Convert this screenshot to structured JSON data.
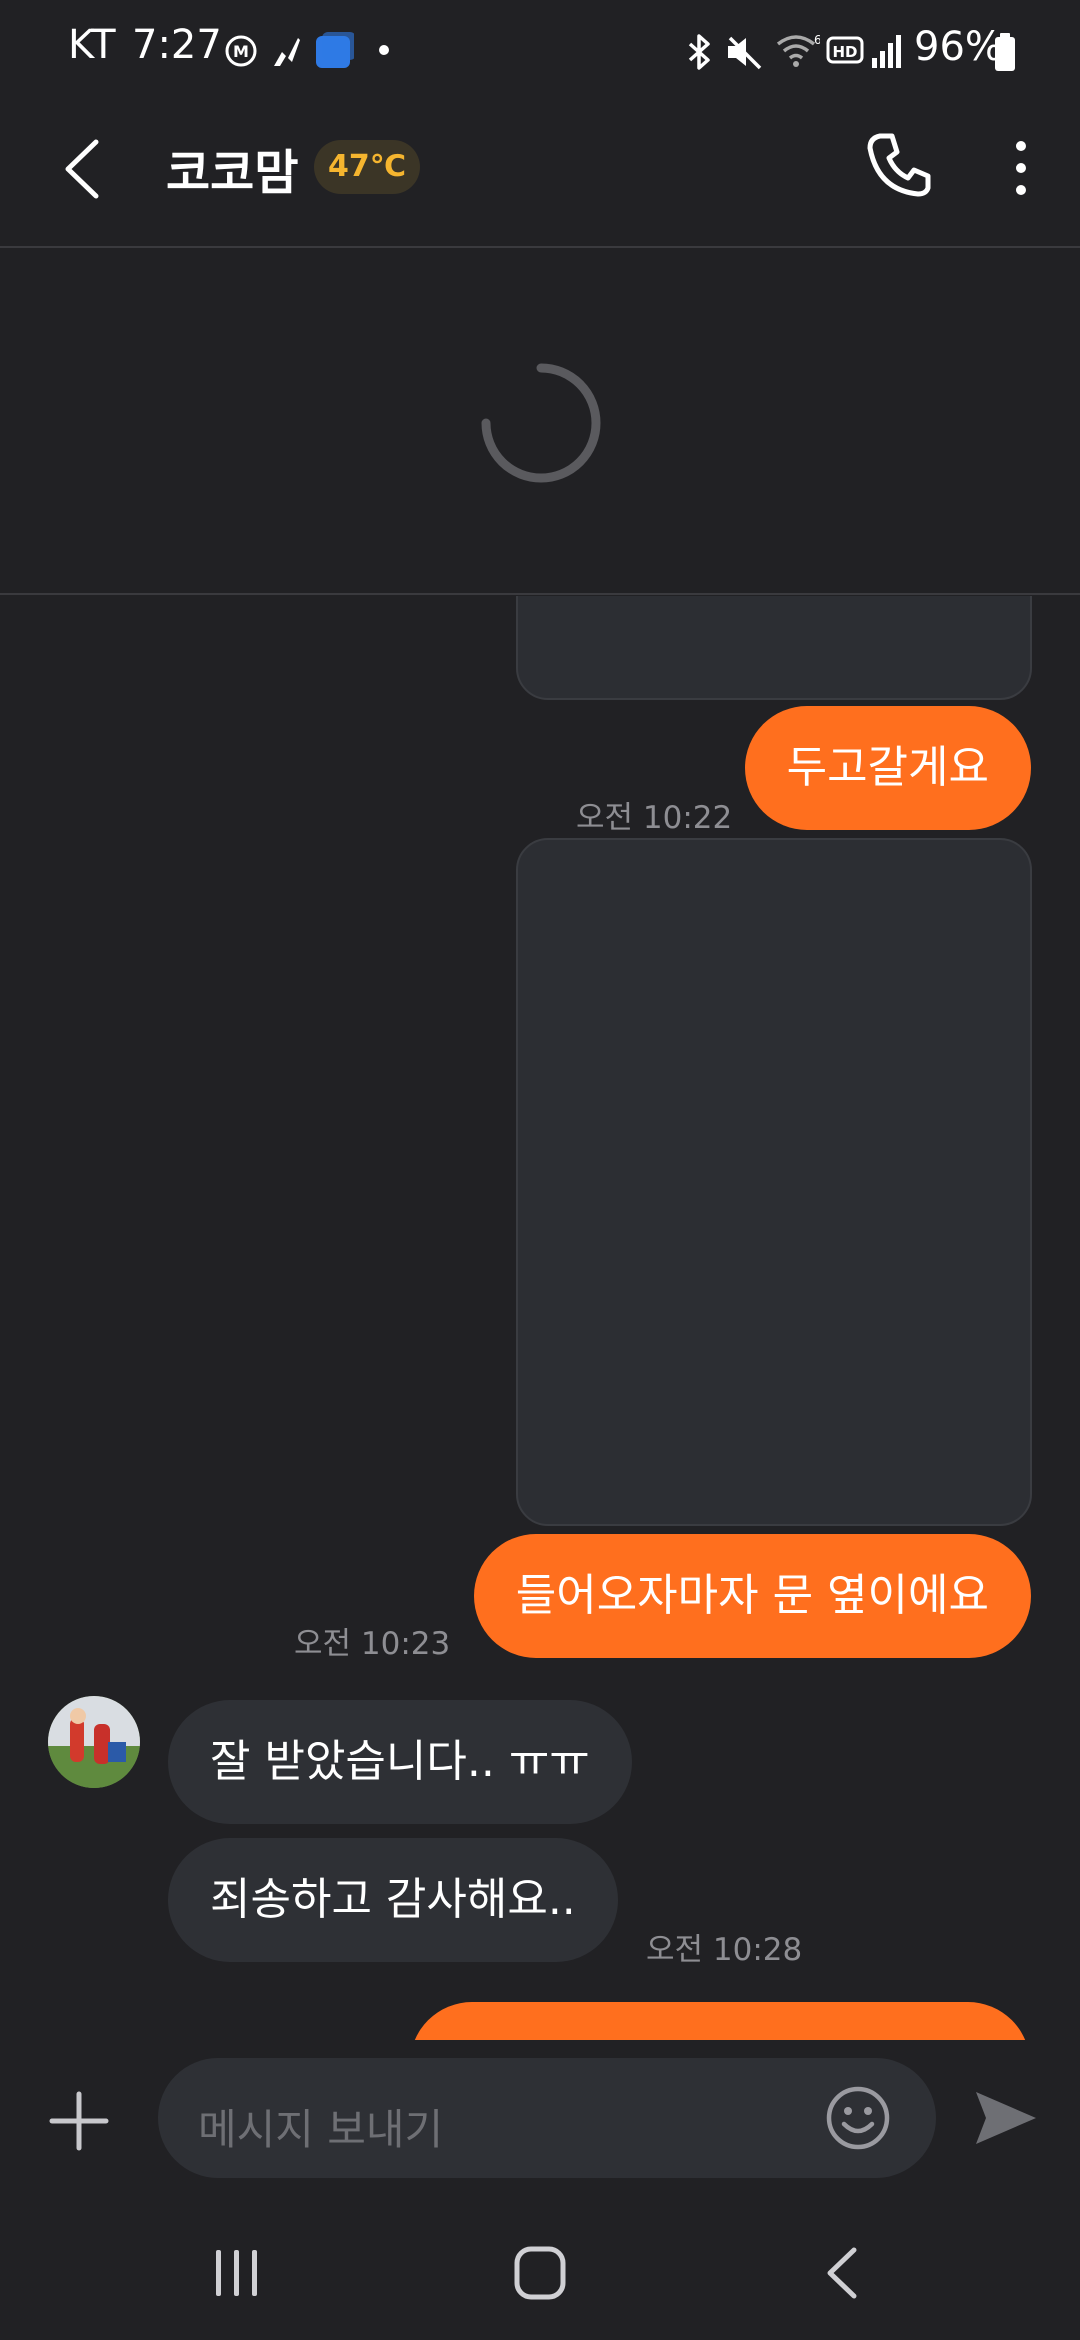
{
  "status_bar": {
    "carrier": "KT",
    "time": "7:27",
    "battery": "96%"
  },
  "header": {
    "title": "코코맘",
    "temperature": "47℃"
  },
  "messages": [
    {
      "text": "두고갈게요"
    },
    {
      "time": "오전 10:22"
    },
    {
      "text": "들어오자마자 문 옆이에요"
    },
    {
      "time": "오전 10:23"
    },
    {
      "text": "잘 받았습니다.. ㅠㅠ"
    },
    {
      "text": "죄송하고 감사해요.."
    },
    {
      "time": "오전 10:28"
    }
  ],
  "composer": {
    "placeholder": "메시지 보내기"
  },
  "colors": {
    "background": "#212124",
    "accent": "#ff6f1e",
    "badge_text": "#f5b52f",
    "incoming_bubble": "#2e3035"
  },
  "icons": [
    "back-arrow-icon",
    "phone-icon",
    "more-vert-icon",
    "loading-spinner-icon",
    "plus-icon",
    "emoji-icon",
    "send-icon",
    "recents-icon",
    "home-icon",
    "nav-back-icon"
  ]
}
